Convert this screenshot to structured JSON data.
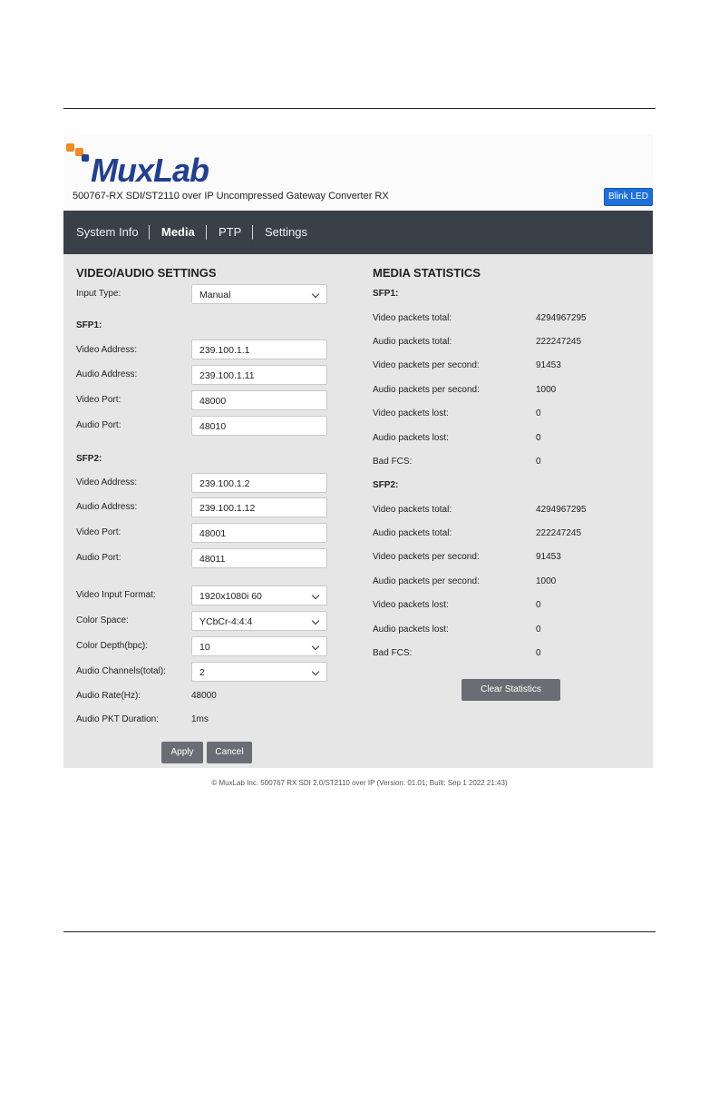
{
  "header": {
    "logo_text": "MuxLab",
    "subtitle": "500767-RX SDI/ST2110 over IP Uncompressed Gateway Converter RX",
    "blink_label": "Blink LED"
  },
  "nav": {
    "system_info": "System Info",
    "media": "Media",
    "ptp": "PTP",
    "settings": "Settings"
  },
  "settings": {
    "title": "VIDEO/AUDIO SETTINGS",
    "input_type_label": "Input Type:",
    "input_type_value": "Manual",
    "sfp1": {
      "heading": "SFP1:",
      "video_address_label": "Video Address:",
      "video_address": "239.100.1.1",
      "audio_address_label": "Audio Address:",
      "audio_address": "239.100.1.11",
      "video_port_label": "Video Port:",
      "video_port": "48000",
      "audio_port_label": "Audio Port:",
      "audio_port": "48010"
    },
    "sfp2": {
      "heading": "SFP2:",
      "video_address_label": "Video Address:",
      "video_address": "239.100.1.2",
      "audio_address_label": "Audio Address:",
      "audio_address": "239.100.1.12",
      "video_port_label": "Video Port:",
      "video_port": "48001",
      "audio_port_label": "Audio Port:",
      "audio_port": "48011"
    },
    "video_input_format_label": "Video Input Format:",
    "video_input_format": "1920x1080i 60",
    "color_space_label": "Color Space:",
    "color_space": "YCbCr-4:4:4",
    "color_depth_label": "Color Depth(bpc):",
    "color_depth": "10",
    "audio_channels_label": "Audio Channels(total):",
    "audio_channels": "2",
    "audio_rate_label": "Audio Rate(Hz):",
    "audio_rate": "48000",
    "audio_pkt_label": "Audio PKT Duration:",
    "audio_pkt": "1ms",
    "apply_label": "Apply",
    "cancel_label": "Cancel"
  },
  "stats": {
    "title": "MEDIA STATISTICS",
    "sfp1": {
      "heading": "SFP1:",
      "rows": [
        {
          "label": "Video packets total:",
          "value": "4294967295"
        },
        {
          "label": "Audio packets total:",
          "value": "222247245"
        },
        {
          "label": "Video packets per second:",
          "value": "91453"
        },
        {
          "label": "Audio packets per second:",
          "value": "1000"
        },
        {
          "label": "Video packets lost:",
          "value": "0"
        },
        {
          "label": "Audio packets lost:",
          "value": "0"
        },
        {
          "label": "Bad FCS:",
          "value": "0"
        }
      ]
    },
    "sfp2": {
      "heading": "SFP2:",
      "rows": [
        {
          "label": "Video packets total:",
          "value": "4294967295"
        },
        {
          "label": "Audio packets total:",
          "value": "222247245"
        },
        {
          "label": "Video packets per second:",
          "value": "91453"
        },
        {
          "label": "Audio packets per second:",
          "value": "1000"
        },
        {
          "label": "Video packets lost:",
          "value": "0"
        },
        {
          "label": "Audio packets lost:",
          "value": "0"
        },
        {
          "label": "Bad FCS:",
          "value": "0"
        }
      ]
    },
    "clear_label": "Clear Statistics"
  },
  "footer": {
    "text": "© MuxLab Inc. 500767 RX SDI 2.0/ST2110 over IP (Version: 01.01; Built: Sep 1 2022 21:43)"
  },
  "colors": {
    "nav_bg": "#3a4047",
    "panel_bg": "#e6e6e6",
    "accent_blue": "#1e6fd8",
    "brand_blue": "#23408e",
    "brand_orange": "#f08a24",
    "button_gray": "#6a6e74"
  }
}
